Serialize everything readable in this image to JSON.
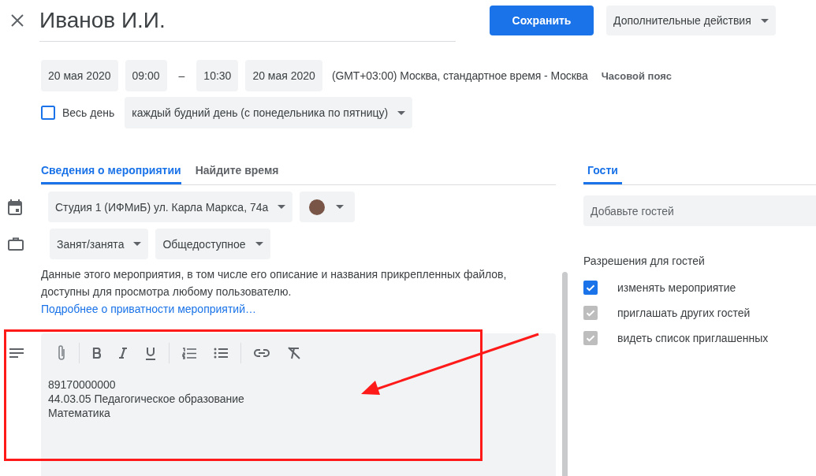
{
  "title": "Иванов И.И.",
  "save_button": "Сохранить",
  "more_actions": "Дополнительные действия",
  "date_time": {
    "start_date": "20 мая 2020",
    "start_time": "09:00",
    "separator": "–",
    "end_time": "10:30",
    "end_date": "20 мая 2020",
    "timezone": "(GMT+03:00) Москва, стандартное время - Москва",
    "timezone_button": "Часовой пояс"
  },
  "all_day": {
    "label": "Весь день",
    "checked": false
  },
  "recurrence": "каждый будний день (с понедельника по пятницу)",
  "tabs": [
    {
      "label": "Сведения о мероприятии",
      "selected": true
    },
    {
      "label": "Найдите время",
      "selected": false
    }
  ],
  "calendar": {
    "value": "Студия 1 (ИФМиБ) ул. Карла Маркса, 74а",
    "color": "#795548"
  },
  "availability": "Занят/занята",
  "visibility": "Общедоступное",
  "privacy_note": "Данные этого мероприятия, в том числе его описание и названия прикрепленных файлов, доступны для просмотра любому пользователю.",
  "privacy_link": "Подробнее о приватности мероприятий…",
  "description": [
    "89170000000",
    "44.03.05 Педагогическое образование",
    "Математика"
  ],
  "guest_tabs": [
    {
      "label": "Гости",
      "selected": true
    }
  ],
  "guests": {
    "placeholder": "Добавьте гостей",
    "permissions_title": "Разрешения для гостей",
    "permissions": [
      {
        "label": "изменять мероприятие",
        "checked": true,
        "disabled": false
      },
      {
        "label": "приглашать других гостей",
        "checked": true,
        "disabled": true
      },
      {
        "label": "видеть список приглашенных",
        "checked": true,
        "disabled": true
      }
    ]
  }
}
